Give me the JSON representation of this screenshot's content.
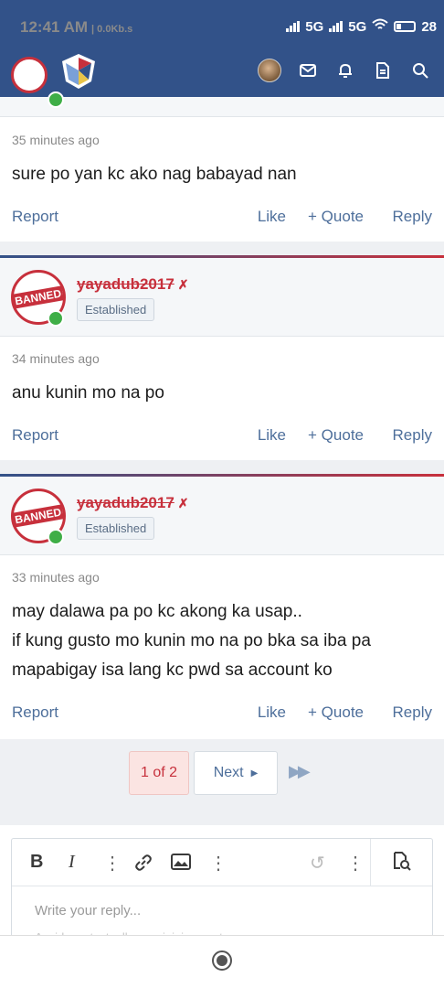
{
  "status_bar": {
    "time": "12:41 AM",
    "speed": "0.0Kb.s",
    "net1": "5G",
    "net2": "5G",
    "battery": "28"
  },
  "posts": [
    {
      "time": "35 minutes ago",
      "body": [
        "sure po yan kc ako nag babayad nan"
      ]
    },
    {
      "author": "yayadub2017",
      "badge": "Established",
      "avatar_text": "BANNED",
      "time": "34 minutes ago",
      "body": [
        "anu kunin mo na po"
      ]
    },
    {
      "author": "yayadub2017",
      "badge": "Established",
      "avatar_text": "BANNED",
      "time": "33 minutes ago",
      "body": [
        "may dalawa pa po kc akong ka usap..",
        "if kung gusto mo kunin mo na po bka sa iba pa",
        "mapabigay isa lang kc pwd sa account ko"
      ]
    }
  ],
  "actions": {
    "report": "Report",
    "like": "Like",
    "quote": "+ Quote",
    "reply": "Reply"
  },
  "pagination": {
    "current": "1 of 2",
    "next": "Next"
  },
  "editor": {
    "bold": "B",
    "italic": "I",
    "placeholder": "Write your reply...",
    "hint": "Avoid any text, all caps, joining posts"
  },
  "colors": {
    "brand": "#325289",
    "accent": "#c7303c",
    "link": "#4e6f9b"
  }
}
